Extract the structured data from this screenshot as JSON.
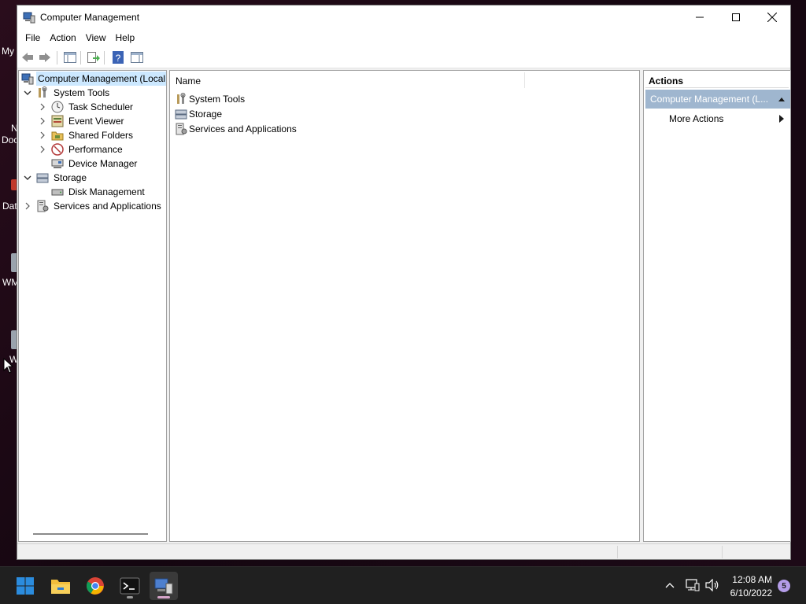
{
  "desktop": {
    "icon_labels": [
      "My",
      "N",
      "Doc",
      "Dat",
      "WM",
      "W"
    ]
  },
  "window": {
    "title": "Computer Management",
    "icon": "computer-management-icon"
  },
  "menu": {
    "items": [
      "File",
      "Action",
      "View",
      "Help"
    ]
  },
  "toolbar": {
    "buttons": [
      "back-arrow-icon",
      "forward-arrow-icon",
      "show-hide-console-tree-icon",
      "export-list-icon",
      "help-icon",
      "show-hide-action-pane-icon"
    ]
  },
  "tree": {
    "root": "Computer Management (Local",
    "system_tools": "System Tools",
    "task_scheduler": "Task Scheduler",
    "event_viewer": "Event Viewer",
    "shared_folders": "Shared Folders",
    "performance": "Performance",
    "device_manager": "Device Manager",
    "storage": "Storage",
    "disk_management": "Disk Management",
    "services_and_applications": "Services and Applications"
  },
  "content": {
    "column_name": "Name",
    "items": [
      "System Tools",
      "Storage",
      "Services and Applications"
    ]
  },
  "actions": {
    "header": "Actions",
    "group": "Computer Management (L...",
    "more_actions": "More Actions"
  },
  "taskbar": {
    "apps": [
      "start-icon",
      "file-explorer-icon",
      "chrome-icon",
      "terminal-icon",
      "computer-management-icon"
    ],
    "time": "12:08 AM",
    "date": "6/10/2022",
    "notification_count": "5"
  },
  "colors": {
    "selection": "#cce8ff",
    "actions_group_bg": "#9fb6cf",
    "taskbar_bg": "#202020",
    "accent": "#0078d4"
  }
}
